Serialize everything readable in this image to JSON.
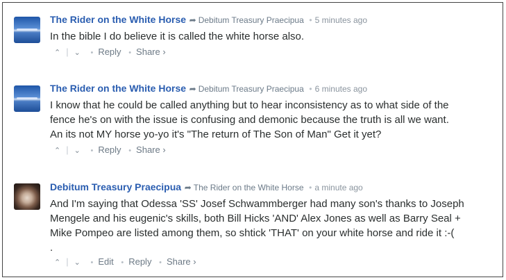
{
  "comments": [
    {
      "author": "The Rider on the White Horse",
      "reply_to": "Debitum Treasury Praecipua",
      "time": "5 minutes ago",
      "lines": [
        "In the bible I do believe it is called the white horse also."
      ],
      "actions": {
        "reply": "Reply",
        "share": "Share ›"
      }
    },
    {
      "author": "The Rider on the White Horse",
      "reply_to": "Debitum Treasury Praecipua",
      "time": "6 minutes ago",
      "lines": [
        "I know that he could be called anything but to hear inconsistency as to what side of the",
        "fence he's on with the issue is confusing and demonic because the truth is all we want.",
        "An its not MY horse yo-yo it's \"The return of The Son of Man\" Get it yet?"
      ],
      "actions": {
        "reply": "Reply",
        "share": "Share ›"
      }
    },
    {
      "author": "Debitum Treasury Praecipua",
      "reply_to": "The Rider on the White Horse",
      "time": "a minute ago",
      "lines": [
        "And I'm saying that Odessa 'SS' Josef Schwammberger had many son's thanks to Joseph",
        "Mengele and his eugenic's skills, both Bill Hicks 'AND' Alex Jones as well as Barry Seal +",
        "Mike Pompeo are listed among them, so shtick 'THAT' on your white horse and ride it :-(",
        "."
      ],
      "actions": {
        "edit": "Edit",
        "reply": "Reply",
        "share": "Share ›"
      }
    }
  ],
  "icons": {
    "upvote": "⌃",
    "downvote": "⌄",
    "reply_arrow": "➦",
    "separator": "•"
  },
  "colors": {
    "author": "#2a5db0",
    "meta": "#8a949e",
    "text": "#2a2e2e"
  }
}
